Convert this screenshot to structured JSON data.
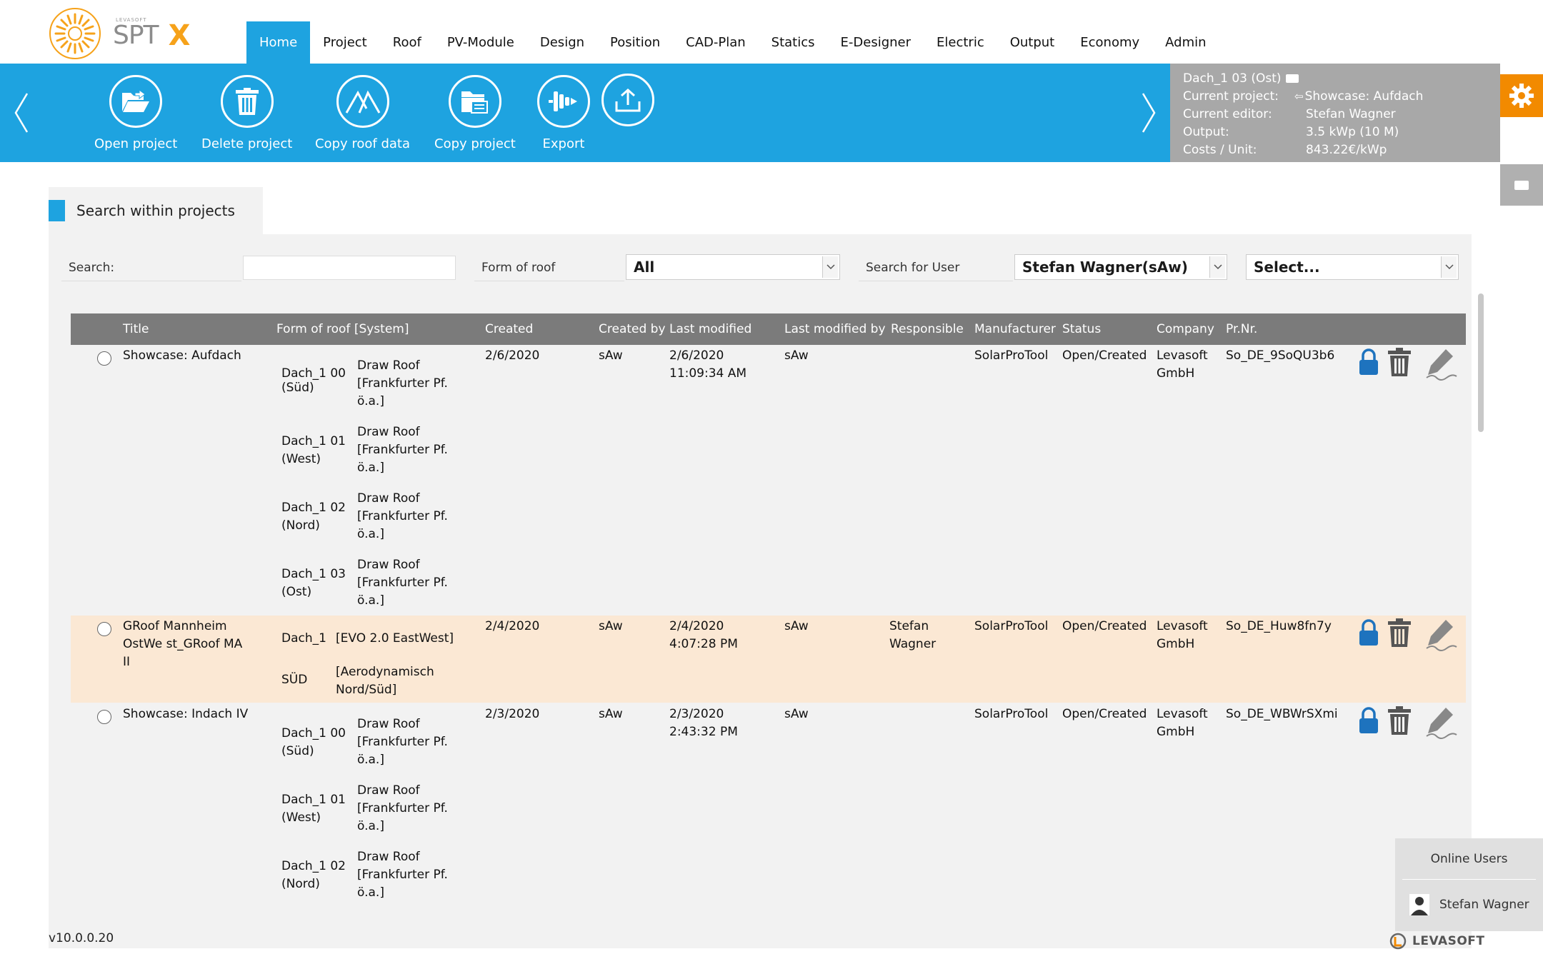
{
  "brand": {
    "name": "SPT",
    "x": "X",
    "small": "LEVASOFT"
  },
  "nav": [
    "Home",
    "Project",
    "Roof",
    "PV-Module",
    "Design",
    "Position",
    "CAD-Plan",
    "Statics",
    "E-Designer",
    "Electric",
    "Output",
    "Economy",
    "Admin"
  ],
  "ribbon": {
    "open": "Open project",
    "delete": "Delete project",
    "copy_roof": "Copy roof data",
    "copy_project": "Copy project",
    "export": "Export"
  },
  "info": {
    "roof": "Dach_1 03 (Ost)",
    "rows": [
      {
        "key": "Current project:",
        "val": "Showcase: Aufdach"
      },
      {
        "key": "Current editor:",
        "val": "Stefan Wagner"
      },
      {
        "key": "Output:",
        "val": "3.5 kWp (10 M)"
      },
      {
        "key": "Costs / Unit:",
        "val": "843.22€/kWp"
      }
    ]
  },
  "search": {
    "tab_label": "Search within projects",
    "search_label": "Search:",
    "search_value": "",
    "form_label": "Form of roof",
    "form_value": "All",
    "user_label": "Search for User",
    "user_value": "Stefan Wagner(sAw)",
    "extra_value": "Select..."
  },
  "table": {
    "headers": [
      "Title",
      "Form of roof [System]",
      "Created",
      "Created by",
      "Last modified",
      "Last modified by",
      "Responsible",
      "Manufacturer",
      "Status",
      "Company",
      "Pr.Nr."
    ],
    "rows": [
      {
        "title": "Showcase: Aufdach",
        "roofs": [
          {
            "name": "Dach_1 00 (Süd)",
            "system": "Draw Roof [Frankfurter Pf. ö.a.]"
          },
          {
            "name": "Dach_1 01 (West)",
            "system": "Draw Roof [Frankfurter Pf. ö.a.]"
          },
          {
            "name": "Dach_1 02 (Nord)",
            "system": "Draw Roof [Frankfurter Pf. ö.a.]"
          },
          {
            "name": "Dach_1 03 (Ost)",
            "system": "Draw Roof [Frankfurter Pf. ö.a.]"
          }
        ],
        "created": "2/6/2020",
        "created_by": "sAw",
        "last_modified": "2/6/2020 11:09:34 AM",
        "last_modified_by": "sAw",
        "responsible": "",
        "manufacturer": "SolarProTool",
        "status": "Open/Created",
        "company": "Levasoft GmbH",
        "prnr": "So_DE_9SoQU3b6"
      },
      {
        "title": "GRoof Mannheim OstWe st_GRoof MA II",
        "roofs": [
          {
            "name": "Dach_1",
            "system": "[EVO 2.0 EastWest]"
          },
          {
            "name": "SÜD",
            "system": "[Aerodynamisch Nord/Süd]"
          }
        ],
        "created": "2/4/2020",
        "created_by": "sAw",
        "last_modified": "2/4/2020 4:07:28 PM",
        "last_modified_by": "sAw",
        "responsible": "Stefan Wagner",
        "manufacturer": "SolarProTool",
        "status": "Open/Created",
        "company": "Levasoft GmbH",
        "prnr": "So_DE_Huw8fn7y"
      },
      {
        "title": "Showcase: Indach IV",
        "roofs": [
          {
            "name": "Dach_1 00 (Süd)",
            "system": "Draw Roof [Frankfurter Pf. ö.a.]"
          },
          {
            "name": "Dach_1 01 (West)",
            "system": "Draw Roof [Frankfurter Pf. ö.a.]"
          },
          {
            "name": "Dach_1 02 (Nord)",
            "system": "Draw Roof [Frankfurter Pf. ö.a.]"
          }
        ],
        "created": "2/3/2020",
        "created_by": "sAw",
        "last_modified": "2/3/2020 2:43:32 PM",
        "last_modified_by": "sAw",
        "responsible": "",
        "manufacturer": "SolarProTool",
        "status": "Open/Created",
        "company": "Levasoft GmbH",
        "prnr": "So_DE_WBWrSXmi"
      }
    ]
  },
  "footer": {
    "version": "v10.0.0.20",
    "company": "LEVASOFT"
  },
  "online": {
    "title": "Online Users",
    "user": "Stefan Wagner"
  },
  "colors": {
    "accent": "#1ea3e0",
    "orange": "#f28a00",
    "header_gray": "#7b7b7b",
    "highlight_row": "#fbe8d4",
    "lock_blue": "#1e73be"
  },
  "icons": [
    "sun-logo-icon",
    "folder-open-icon",
    "trash-icon",
    "roof-icon",
    "copy-folder-icon",
    "export-icon",
    "upload-icon",
    "gear-icon",
    "lock-icon",
    "edit-icon",
    "user-icon"
  ]
}
